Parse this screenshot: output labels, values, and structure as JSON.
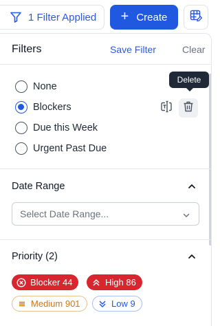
{
  "toolbar": {
    "filter_label": "1 Filter Applied",
    "create_label": "Create"
  },
  "panel": {
    "title": "Filters",
    "save_label": "Save Filter",
    "clear_label": "Clear"
  },
  "presets": [
    {
      "label": "None",
      "selected": false
    },
    {
      "label": "Blockers",
      "selected": true
    },
    {
      "label": "Due this Week",
      "selected": false
    },
    {
      "label": "Urgent Past Due",
      "selected": false
    }
  ],
  "tooltip": "Delete",
  "date_range": {
    "title": "Date Range",
    "placeholder": "Select Date Range..."
  },
  "priority": {
    "title": "Priority (2)",
    "chips": [
      {
        "label": "Blocker 44"
      },
      {
        "label": "High 86"
      },
      {
        "label": "Medium 901"
      },
      {
        "label": "Low 9"
      }
    ]
  },
  "colors": {
    "accent": "#2158e0",
    "danger": "#d7262f",
    "medium": "#c7781a"
  }
}
